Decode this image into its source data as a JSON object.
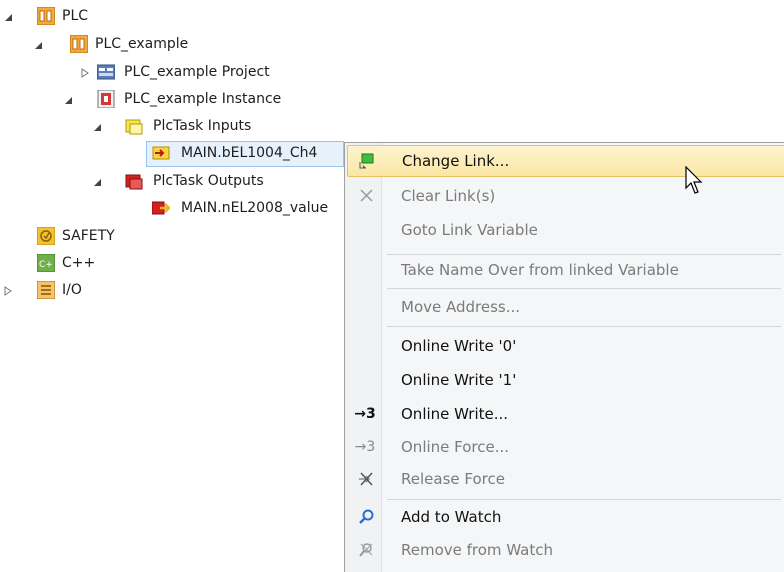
{
  "tree": {
    "plc": "PLC",
    "plc_example": "PLC_example",
    "plc_example_project": "PLC_example Project",
    "plc_example_instance": "PLC_example Instance",
    "plctask_inputs": "PlcTask Inputs",
    "main_bel1004": "MAIN.bEL1004_Ch4",
    "plctask_outputs": "PlcTask Outputs",
    "main_nel2008": "MAIN.nEL2008_value",
    "safety": "SAFETY",
    "cpp": "C++",
    "io": "I/O"
  },
  "menu": {
    "change_link": "Change Link...",
    "clear_links": "Clear Link(s)",
    "goto_link": "Goto Link Variable",
    "take_name": "Take Name Over from linked Variable",
    "move_address": "Move Address...",
    "online_write_0": "Online Write '0'",
    "online_write_1": "Online Write '1'",
    "online_write": "Online Write...",
    "online_force": "Online Force...",
    "release_force": "Release Force",
    "add_to_watch": "Add to Watch",
    "remove_from_watch": "Remove from Watch",
    "online_write_glyph": "→3",
    "online_force_glyph": "→3"
  },
  "colors": {
    "menu_highlight": "#fbe7a4",
    "selection": "#e6f1fc",
    "plc_icon": "#f0a030",
    "input_icon": "#f5e042",
    "output_icon": "#d02020"
  }
}
